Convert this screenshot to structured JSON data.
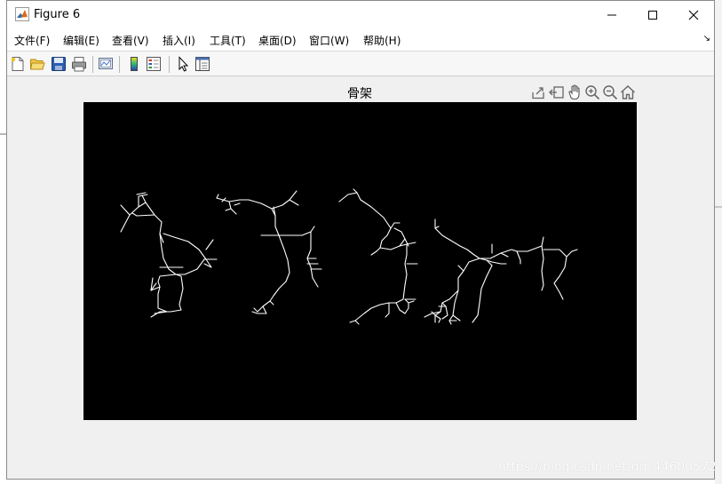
{
  "window": {
    "title": "Figure 6"
  },
  "menu": [
    {
      "label": "文件(F)"
    },
    {
      "label": "编辑(E)"
    },
    {
      "label": "查看(V)"
    },
    {
      "label": "插入(I)"
    },
    {
      "label": "工具(T)"
    },
    {
      "label": "桌面(D)"
    },
    {
      "label": "窗口(W)"
    },
    {
      "label": "帮助(H)"
    }
  ],
  "toolbar": {
    "buttons": [
      "new-figure-icon",
      "open-file-icon",
      "save-icon",
      "print-icon",
      "link-plot-icon",
      "insert-colorbar-icon",
      "insert-legend-icon",
      "edit-plot-icon",
      "property-inspector-icon"
    ]
  },
  "axes": {
    "title": "骨架",
    "toolbar_icons": [
      "export-icon",
      "brush-icon",
      "pan-hand-icon",
      "zoom-in-icon",
      "zoom-out-icon",
      "home-icon"
    ]
  },
  "image": {
    "background": "#000000",
    "foreground": "#ffffff"
  },
  "watermark": "https://blog.csdn.net/qq_44600572"
}
